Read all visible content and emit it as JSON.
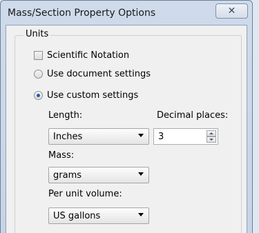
{
  "window": {
    "title": "Mass/Section Property Options",
    "close_symbol": "✕"
  },
  "units": {
    "legend": "Units",
    "scientific_notation": {
      "label": "Scientific Notation",
      "checked": false
    },
    "use_document_settings": {
      "label": "Use document settings",
      "selected": false
    },
    "use_custom_settings": {
      "label": "Use custom settings",
      "selected": true
    },
    "length": {
      "label": "Length:",
      "value": "Inches"
    },
    "decimal_places": {
      "label": "Decimal places:",
      "value": "3"
    },
    "mass": {
      "label": "Mass:",
      "value": "grams"
    },
    "per_unit_volume": {
      "label": "Per unit volume:",
      "value": "US gallons"
    }
  }
}
